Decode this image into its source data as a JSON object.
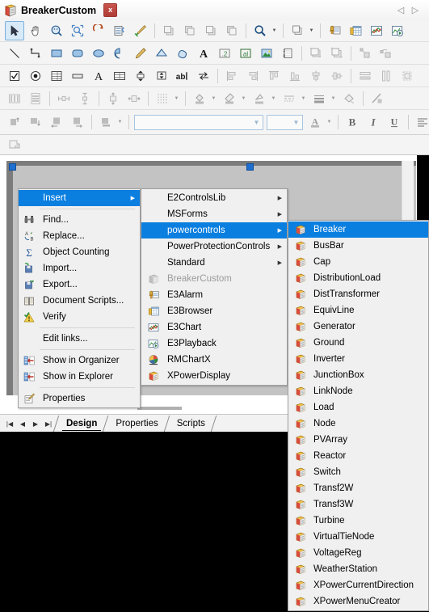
{
  "titlebar": {
    "title": "BreakerCustom",
    "close_label": "x",
    "doc_icon": "document-stack-icon",
    "nav_prev": "◁",
    "nav_next": "▷"
  },
  "toolbars": {
    "row1": [
      {
        "name": "select-arrow-tool",
        "type": "button",
        "selected": true
      },
      {
        "name": "pan-hand-tool",
        "type": "button"
      },
      {
        "name": "zoom-fit-tool",
        "type": "button"
      },
      {
        "name": "zoom-region-tool",
        "type": "button"
      },
      {
        "name": "rotate-tool",
        "type": "button"
      },
      {
        "name": "script-list-tool",
        "type": "button"
      },
      {
        "name": "format-painter-tool",
        "type": "button"
      },
      {
        "type": "separator"
      },
      {
        "name": "bring-to-front-tool",
        "type": "button",
        "disabled": true
      },
      {
        "name": "send-to-back-tool",
        "type": "button",
        "disabled": true
      },
      {
        "name": "bring-forward-tool",
        "type": "button",
        "disabled": true
      },
      {
        "name": "send-backward-tool",
        "type": "button",
        "disabled": true
      },
      {
        "type": "separator"
      },
      {
        "name": "zoom-magnifier-tool",
        "type": "split-button"
      },
      {
        "type": "separator"
      },
      {
        "name": "group-objects-tool",
        "type": "split-button"
      },
      {
        "type": "separator"
      },
      {
        "name": "e3alarm-tool",
        "type": "button"
      },
      {
        "name": "e3browser-tool",
        "type": "button"
      },
      {
        "name": "e3chart-tool",
        "type": "button"
      },
      {
        "name": "e3playback-tool",
        "type": "button"
      }
    ],
    "row2": [
      {
        "name": "line-tool",
        "type": "button"
      },
      {
        "name": "polyline-tool",
        "type": "button"
      },
      {
        "name": "rectangle-tool",
        "type": "button"
      },
      {
        "name": "rounded-rectangle-tool",
        "type": "button"
      },
      {
        "name": "ellipse-tool",
        "type": "button"
      },
      {
        "name": "pie-tool",
        "type": "button"
      },
      {
        "name": "pencil-tool",
        "type": "button"
      },
      {
        "name": "polygon-tool",
        "type": "button"
      },
      {
        "name": "freeform-tool",
        "type": "button"
      },
      {
        "name": "text-tool",
        "type": "button"
      },
      {
        "name": "numeric-display-tool",
        "type": "button"
      },
      {
        "name": "alpha-display-tool",
        "type": "button"
      },
      {
        "name": "image-tool",
        "type": "button"
      },
      {
        "name": "counter-tool",
        "type": "button"
      },
      {
        "type": "separator"
      },
      {
        "name": "group-tool",
        "type": "button",
        "disabled": true
      },
      {
        "name": "ungroup-tool",
        "type": "button",
        "disabled": true
      },
      {
        "type": "separator"
      },
      {
        "name": "combine-tool",
        "type": "button",
        "disabled": true
      },
      {
        "name": "split-tool",
        "type": "button",
        "disabled": true
      }
    ],
    "row3": [
      {
        "name": "checkbox-control-tool",
        "type": "button"
      },
      {
        "name": "radio-control-tool",
        "type": "button"
      },
      {
        "name": "listbox-control-tool",
        "type": "button"
      },
      {
        "name": "button-control-tool",
        "type": "button"
      },
      {
        "name": "label-control-tool",
        "type": "button"
      },
      {
        "name": "grid-control-tool",
        "type": "button"
      },
      {
        "name": "spinner-control-tool",
        "type": "button"
      },
      {
        "name": "slider-control-tool",
        "type": "button"
      },
      {
        "name": "textbox-control-tool",
        "type": "button"
      },
      {
        "name": "scrollbar-control-tool",
        "type": "button"
      },
      {
        "type": "separator"
      },
      {
        "name": "align-left-tool",
        "type": "button",
        "disabled": true
      },
      {
        "name": "align-right-tool",
        "type": "button",
        "disabled": true
      },
      {
        "name": "align-top-tool",
        "type": "button",
        "disabled": true
      },
      {
        "name": "align-bottom-tool",
        "type": "button",
        "disabled": true
      },
      {
        "name": "align-center-vertical-tool",
        "type": "button",
        "disabled": true
      },
      {
        "name": "align-center-horizontal-tool",
        "type": "button",
        "disabled": true
      },
      {
        "type": "separator"
      },
      {
        "name": "make-same-width-tool",
        "type": "button",
        "disabled": true
      },
      {
        "name": "make-same-height-tool",
        "type": "button",
        "disabled": true
      },
      {
        "name": "make-same-size-tool",
        "type": "button",
        "disabled": true
      }
    ],
    "row4": [
      {
        "name": "distribute-horizontal-tool",
        "type": "button",
        "disabled": true
      },
      {
        "name": "distribute-vertical-tool",
        "type": "button",
        "disabled": true
      },
      {
        "type": "separator"
      },
      {
        "name": "space-across-tool",
        "type": "button",
        "disabled": true
      },
      {
        "name": "space-down-tool",
        "type": "button",
        "disabled": true
      },
      {
        "type": "separator"
      },
      {
        "name": "center-vertically-tool",
        "type": "button",
        "disabled": true
      },
      {
        "name": "center-horizontally-tool",
        "type": "button",
        "disabled": true
      },
      {
        "type": "separator"
      },
      {
        "name": "grid-snap-tool",
        "type": "split-button"
      },
      {
        "type": "separator"
      },
      {
        "name": "fill-color-tool",
        "type": "split-button"
      },
      {
        "name": "gradient-fill-tool",
        "type": "split-button"
      },
      {
        "name": "line-color-tool",
        "type": "split-button"
      },
      {
        "name": "line-style-tool",
        "type": "split-button"
      },
      {
        "name": "line-weight-tool",
        "type": "split-button"
      },
      {
        "name": "fill-pattern-tool",
        "type": "button"
      },
      {
        "type": "separator"
      },
      {
        "name": "transparency-tool",
        "type": "button"
      }
    ],
    "row5": [
      {
        "name": "shadow-up-tool",
        "type": "button",
        "disabled": true
      },
      {
        "name": "shadow-down-tool",
        "type": "button",
        "disabled": true
      },
      {
        "name": "shadow-left-tool",
        "type": "button",
        "disabled": true
      },
      {
        "name": "shadow-right-tool",
        "type": "button",
        "disabled": true
      },
      {
        "type": "separator"
      },
      {
        "name": "shadow-style-tool",
        "type": "split-button",
        "disabled": true
      },
      {
        "type": "separator"
      },
      {
        "name": "font-name-combo",
        "type": "combo",
        "value": "",
        "placeholder": ""
      },
      {
        "name": "font-size-combo",
        "type": "combo",
        "value": "",
        "placeholder": ""
      },
      {
        "name": "font-color-tool",
        "type": "split-button",
        "disabled": true
      },
      {
        "type": "separator"
      },
      {
        "name": "bold-tool",
        "type": "button",
        "label": "B",
        "disabled": true
      },
      {
        "name": "italic-tool",
        "type": "button",
        "label": "I",
        "disabled": true
      },
      {
        "name": "underline-tool",
        "type": "button",
        "label": "U",
        "disabled": true
      },
      {
        "type": "separator"
      },
      {
        "name": "align-text-left-tool",
        "type": "button",
        "disabled": true
      },
      {
        "name": "align-text-center-tool",
        "type": "button",
        "disabled": true
      },
      {
        "name": "align-text-right-tool",
        "type": "button",
        "disabled": true
      }
    ],
    "row6": [
      {
        "name": "object-properties-tool",
        "type": "button",
        "disabled": true
      }
    ]
  },
  "context_menu": {
    "items": [
      {
        "label": "Insert",
        "icon": "",
        "highlighted": true,
        "submenu": true
      },
      {
        "separator": true
      },
      {
        "label": "Find...",
        "icon": "binoculars-icon"
      },
      {
        "label": "Replace...",
        "icon": "replace-icon"
      },
      {
        "label": "Object Counting",
        "icon": "sigma-icon"
      },
      {
        "label": "Import...",
        "icon": "import-icon"
      },
      {
        "label": "Export...",
        "icon": "export-icon"
      },
      {
        "label": "Document Scripts...",
        "icon": "book-icon"
      },
      {
        "label": "Verify",
        "icon": "verify-warning-icon"
      },
      {
        "separator": true
      },
      {
        "label": "Edit links...",
        "icon": ""
      },
      {
        "separator": true
      },
      {
        "label": "Show in Organizer",
        "icon": "organizer-icon"
      },
      {
        "label": "Show in Explorer",
        "icon": "explorer-icon"
      },
      {
        "separator": true
      },
      {
        "label": "Properties",
        "icon": "properties-icon"
      }
    ]
  },
  "insert_submenu": {
    "items": [
      {
        "label": "E2ControlsLib",
        "icon": "",
        "submenu": true
      },
      {
        "label": "MSForms",
        "icon": "",
        "submenu": true
      },
      {
        "label": "powercontrols",
        "icon": "",
        "submenu": true,
        "highlighted": true
      },
      {
        "label": "PowerProtectionControls",
        "icon": "",
        "submenu": true
      },
      {
        "label": "Standard",
        "icon": "",
        "submenu": true
      },
      {
        "label": "BreakerCustom",
        "icon": "component-gray-icon",
        "disabled": true
      },
      {
        "label": "E3Alarm",
        "icon": "e3alarm-icon"
      },
      {
        "label": "E3Browser",
        "icon": "e3browser-icon"
      },
      {
        "label": "E3Chart",
        "icon": "e3chart-icon"
      },
      {
        "label": "E3Playback",
        "icon": "e3playback-icon"
      },
      {
        "label": "RMChartX",
        "icon": "rmchartx-icon"
      },
      {
        "label": "XPowerDisplay",
        "icon": "xpowerdisplay-icon"
      }
    ]
  },
  "powercontrols_submenu": {
    "items": [
      {
        "label": "Breaker",
        "icon": "component-icon",
        "highlighted": true
      },
      {
        "label": "BusBar",
        "icon": "component-icon"
      },
      {
        "label": "Cap",
        "icon": "component-icon"
      },
      {
        "label": "DistributionLoad",
        "icon": "component-icon"
      },
      {
        "label": "DistTransformer",
        "icon": "component-icon"
      },
      {
        "label": "EquivLine",
        "icon": "component-icon"
      },
      {
        "label": "Generator",
        "icon": "component-icon"
      },
      {
        "label": "Ground",
        "icon": "component-icon"
      },
      {
        "label": "Inverter",
        "icon": "component-icon"
      },
      {
        "label": "JunctionBox",
        "icon": "component-icon"
      },
      {
        "label": "LinkNode",
        "icon": "component-icon"
      },
      {
        "label": "Load",
        "icon": "component-icon"
      },
      {
        "label": "Node",
        "icon": "component-icon"
      },
      {
        "label": "PVArray",
        "icon": "component-icon"
      },
      {
        "label": "Reactor",
        "icon": "component-icon"
      },
      {
        "label": "Switch",
        "icon": "component-icon"
      },
      {
        "label": "Transf2W",
        "icon": "component-icon"
      },
      {
        "label": "Transf3W",
        "icon": "component-icon"
      },
      {
        "label": "Turbine",
        "icon": "component-icon"
      },
      {
        "label": "VirtualTieNode",
        "icon": "component-icon"
      },
      {
        "label": "VoltageReg",
        "icon": "component-icon"
      },
      {
        "label": "WeatherStation",
        "icon": "component-icon"
      },
      {
        "label": "XPowerCurrentDirection",
        "icon": "component-icon"
      },
      {
        "label": "XPowerMenuCreator",
        "icon": "component-icon"
      }
    ]
  },
  "tabstrip": {
    "nav": [
      "|◀",
      "◀",
      "▶",
      "▶|"
    ],
    "tabs": [
      {
        "label": "Design",
        "active": true
      },
      {
        "label": "Properties",
        "active": false
      },
      {
        "label": "Scripts",
        "active": false
      }
    ]
  },
  "colors": {
    "menu_highlight": "#0a7fe0",
    "toolbar_bg": "#f4f4f4",
    "canvas_bg": "#c3c3c3",
    "handle": "#1f6fd0"
  }
}
